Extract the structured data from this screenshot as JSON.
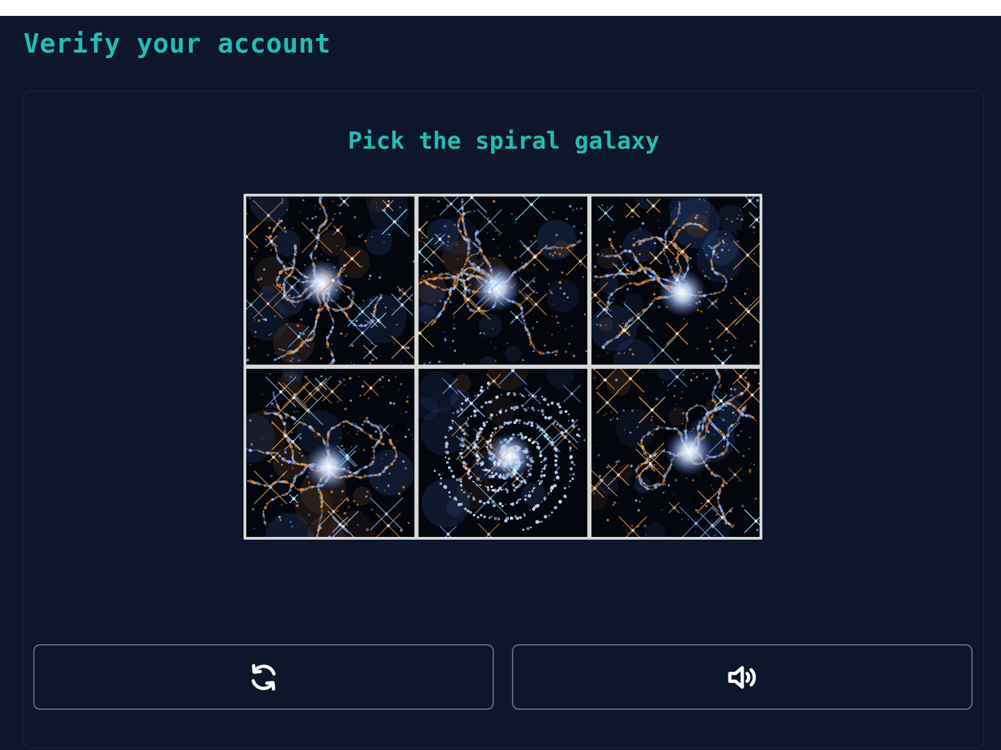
{
  "header": {
    "title": "Verify your account"
  },
  "captcha": {
    "prompt": "Pick the spiral galaxy",
    "tiles": [
      {
        "name": "tile-1",
        "kind": "irregular galaxy"
      },
      {
        "name": "tile-2",
        "kind": "irregular galaxy"
      },
      {
        "name": "tile-3",
        "kind": "irregular galaxy"
      },
      {
        "name": "tile-4",
        "kind": "irregular galaxy"
      },
      {
        "name": "tile-5",
        "kind": "spiral galaxy"
      },
      {
        "name": "tile-6",
        "kind": "irregular galaxy"
      }
    ],
    "buttons": {
      "refresh_icon": "refresh-icon",
      "audio_icon": "speaker-icon"
    }
  },
  "colors": {
    "background": "#0e162b",
    "accent": "#22bdb3",
    "button_border": "#5c6780",
    "grid_border": "#d7d7d7"
  }
}
